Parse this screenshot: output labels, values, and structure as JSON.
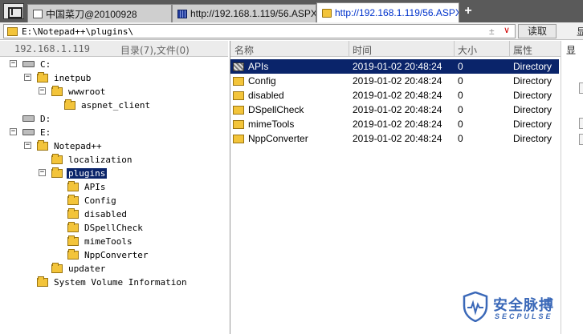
{
  "tabs": [
    {
      "label": "中国菜刀@20100928",
      "icon": "page-icon"
    },
    {
      "label": "http://192.168.1.119/56.ASPX",
      "icon": "globe-icon"
    },
    {
      "label": "http://192.168.1.119/56.ASPX",
      "icon": "folder-icon"
    }
  ],
  "tab_add_label": "+",
  "address": {
    "path": "E:\\Notepad++\\plugins\\",
    "history_glyph": "±",
    "dropdown_glyph": "∨",
    "read_button": "读取",
    "cut_glyph": "显"
  },
  "left_header": {
    "ip": "192.168.1.119",
    "dir_count": "目录(7),文件(0)"
  },
  "tree": [
    {
      "label": "C:",
      "kind": "drive",
      "expander": "−"
    },
    {
      "label": "inetpub",
      "kind": "folder",
      "expander": "−"
    },
    {
      "label": "wwwroot",
      "kind": "folder",
      "expander": "−"
    },
    {
      "label": "aspnet_client",
      "kind": "folder",
      "expander": ""
    },
    {
      "label": "D:",
      "kind": "drive",
      "expander": ""
    },
    {
      "label": "E:",
      "kind": "drive",
      "expander": "−"
    },
    {
      "label": "Notepad++",
      "kind": "folder",
      "expander": "−"
    },
    {
      "label": "localization",
      "kind": "folder",
      "expander": ""
    },
    {
      "label": "plugins",
      "kind": "folder",
      "expander": "−",
      "selected": true
    },
    {
      "label": "APIs",
      "kind": "folder",
      "expander": ""
    },
    {
      "label": "Config",
      "kind": "folder",
      "expander": ""
    },
    {
      "label": "disabled",
      "kind": "folder",
      "expander": ""
    },
    {
      "label": "DSpellCheck",
      "kind": "folder",
      "expander": ""
    },
    {
      "label": "mimeTools",
      "kind": "folder",
      "expander": ""
    },
    {
      "label": "NppConverter",
      "kind": "folder",
      "expander": ""
    },
    {
      "label": "updater",
      "kind": "folder",
      "expander": ""
    },
    {
      "label": "System Volume Information",
      "kind": "folder",
      "expander": ""
    }
  ],
  "columns": {
    "name": "名称",
    "time": "时间",
    "size": "大小",
    "attr": "属性"
  },
  "files": [
    {
      "name": "APIs",
      "time": "2019-01-02 20:48:24",
      "size": "0",
      "attr": "Directory",
      "selected": true
    },
    {
      "name": "Config",
      "time": "2019-01-02 20:48:24",
      "size": "0",
      "attr": "Directory"
    },
    {
      "name": "disabled",
      "time": "2019-01-02 20:48:24",
      "size": "0",
      "attr": "Directory"
    },
    {
      "name": "DSpellCheck",
      "time": "2019-01-02 20:48:24",
      "size": "0",
      "attr": "Directory"
    },
    {
      "name": "mimeTools",
      "time": "2019-01-02 20:48:24",
      "size": "0",
      "attr": "Directory"
    },
    {
      "name": "NppConverter",
      "time": "2019-01-02 20:48:24",
      "size": "0",
      "attr": "Directory"
    }
  ],
  "right_panel_glyph": "显",
  "watermark": {
    "cn": "安全脉搏",
    "en": "SECPULSE"
  },
  "colors": {
    "selection": "#0a246a",
    "folder": "#f3c43a",
    "active_tab_text": "#0033cc",
    "watermark": "#3a68b8"
  }
}
